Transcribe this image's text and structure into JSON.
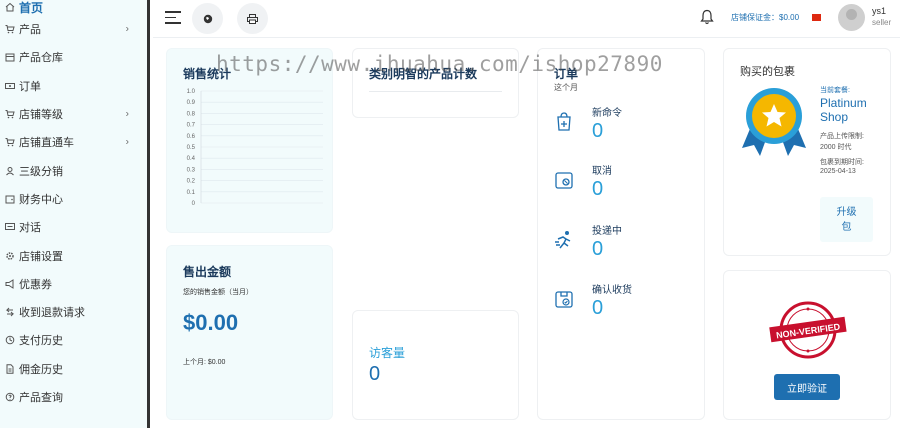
{
  "sidebar": {
    "items": [
      {
        "label": "首页",
        "icon": "home-icon",
        "chevron": false
      },
      {
        "label": "产品",
        "icon": "cart-icon",
        "chevron": true
      },
      {
        "label": "产品仓库",
        "icon": "box-icon",
        "chevron": false
      },
      {
        "label": "订单",
        "icon": "ticket-icon",
        "chevron": false
      },
      {
        "label": "店铺等级",
        "icon": "cart-icon",
        "chevron": true
      },
      {
        "label": "店铺直通车",
        "icon": "cart-icon",
        "chevron": true
      },
      {
        "label": "三级分销",
        "icon": "user-icon",
        "chevron": false
      },
      {
        "label": "财务中心",
        "icon": "wallet-icon",
        "chevron": false
      },
      {
        "label": "对话",
        "icon": "chat-icon",
        "chevron": false
      },
      {
        "label": "店铺设置",
        "icon": "gear-icon",
        "chevron": false
      },
      {
        "label": "优惠券",
        "icon": "megaphone-icon",
        "chevron": false
      },
      {
        "label": "收到退款请求",
        "icon": "refund-icon",
        "chevron": false
      },
      {
        "label": "支付历史",
        "icon": "history-icon",
        "chevron": false
      },
      {
        "label": "佣金历史",
        "icon": "file-icon",
        "chevron": false
      },
      {
        "label": "产品查询",
        "icon": "question-icon",
        "chevron": false
      }
    ]
  },
  "header": {
    "deposit": "店铺保证金：$0.00",
    "user_name": "ys1",
    "user_role": "seller"
  },
  "watermark": "https://www.ihuahua.com/ishop27890",
  "sales_stats": {
    "title": "销售统计"
  },
  "chart_data": {
    "type": "bar",
    "title": "销售统计",
    "categories": [],
    "values": [],
    "yticks": [
      "1.0",
      "0.9",
      "0.8",
      "0.7",
      "0.6",
      "0.5",
      "0.4",
      "0.3",
      "0.2",
      "0.1",
      "0"
    ],
    "ylim": [
      0,
      1
    ],
    "grid": true
  },
  "category_products": {
    "title": "类别明智的产品计数"
  },
  "orders": {
    "title": "订单",
    "subtitle": "这个月",
    "rows": [
      {
        "label": "新命令",
        "value": "0",
        "icon": "cart-plus-icon"
      },
      {
        "label": "取消",
        "value": "0",
        "icon": "cancel-icon"
      },
      {
        "label": "投递中",
        "value": "0",
        "icon": "running-icon"
      },
      {
        "label": "确认收货",
        "value": "0",
        "icon": "check-box-icon"
      }
    ]
  },
  "package": {
    "title": "购买的包裹",
    "current_label": "当前套餐:",
    "name": "Platinum Shop",
    "upload_label": "产品上传限制:",
    "upload_value": "2000 时代",
    "expiry_label": "包裹到期时间:",
    "expiry_value": "2025-04-13",
    "upgrade_line1": "升级",
    "upgrade_line2": "包"
  },
  "sold_amount": {
    "title": "售出金额",
    "subtitle": "您的销售金额（当月）",
    "amount": "$0.00",
    "last_month": "上个月: $0.00"
  },
  "visitors": {
    "title": "访客量",
    "value": "0"
  },
  "verification": {
    "stamp_text": "NON-VERIFIED",
    "button_label": "立即验证"
  }
}
